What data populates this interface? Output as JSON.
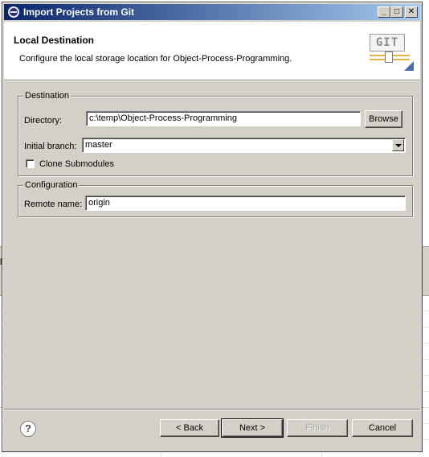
{
  "window": {
    "title": "Import Projects from Git",
    "controls": {
      "minimize": "_",
      "maximize": "□",
      "close": "✕"
    }
  },
  "banner": {
    "title": "Local Destination",
    "description": "Configure the local storage location for Object-Process-Programming.",
    "logo_text": "GIT"
  },
  "destination": {
    "legend": "Destination",
    "directory_label": "Directory:",
    "directory_value": "c:\\temp\\Object-Process-Programming",
    "browse_label": "Browse",
    "branch_label": "Initial branch:",
    "branch_value": "master",
    "clone_submodules_label": "Clone Submodules",
    "clone_submodules_checked": false
  },
  "configuration": {
    "legend": "Configuration",
    "remote_label": "Remote name:",
    "remote_value": "origin"
  },
  "footer": {
    "help_glyph": "?",
    "back_label": "< Back",
    "next_label": "Next >",
    "finish_label": "Finish",
    "cancel_label": "Cancel"
  },
  "background": {
    "clipped_text": "la"
  },
  "colors": {
    "dialog_face": "#d4d0c8",
    "titlebar_start": "#0a246a",
    "titlebar_end": "#a6caf0"
  }
}
